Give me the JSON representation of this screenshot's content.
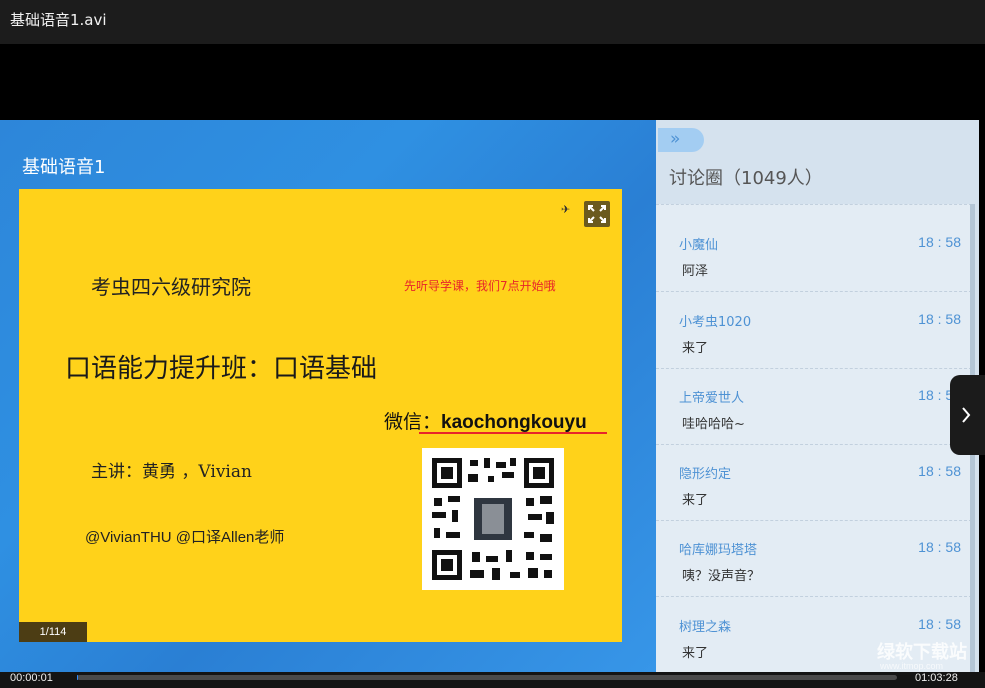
{
  "window": {
    "title": "基础语音1.avi"
  },
  "slide": {
    "stage_title": "基础语音1",
    "org": "考虫四六级研究院",
    "notice": "先听导学课，我们7点开始哦",
    "course_title": "口语能力提升班：口语基础",
    "wechat_label": "微信：",
    "wechat_id": "kaochongkouyu",
    "lecturer": "主讲：黄勇 ，Vivian",
    "weibo": "@VivianTHU @口译Allen老师",
    "page_indicator": "1/114"
  },
  "chat": {
    "header": "讨论圈（1049人）",
    "collapse_icon": "»",
    "messages": [
      {
        "user": "小魔仙",
        "time": "18 : 58",
        "text": "阿泽"
      },
      {
        "user": "小考虫1020",
        "time": "18 : 58",
        "text": "来了"
      },
      {
        "user": "上帝爱世人",
        "time": "18 : 58",
        "text": "哇哈哈哈~"
      },
      {
        "user": "隐形约定",
        "time": "18 : 58",
        "text": "来了"
      },
      {
        "user": "哈库娜玛塔塔",
        "time": "18 : 58",
        "text": "咦？没声音？"
      },
      {
        "user": "树理之森",
        "time": "18 : 58",
        "text": "来了"
      }
    ]
  },
  "watermark": {
    "brand": "绿软下载站",
    "url": "www.itmop.com"
  },
  "player": {
    "current_time": "00:00:01",
    "total_time": "01:03:28",
    "progress": 0.0003
  },
  "colors": {
    "accent": "#2e8bff",
    "slide_bg": "#ffd21a",
    "notice_red": "#e8252a",
    "chat_name": "#4e92d4"
  }
}
